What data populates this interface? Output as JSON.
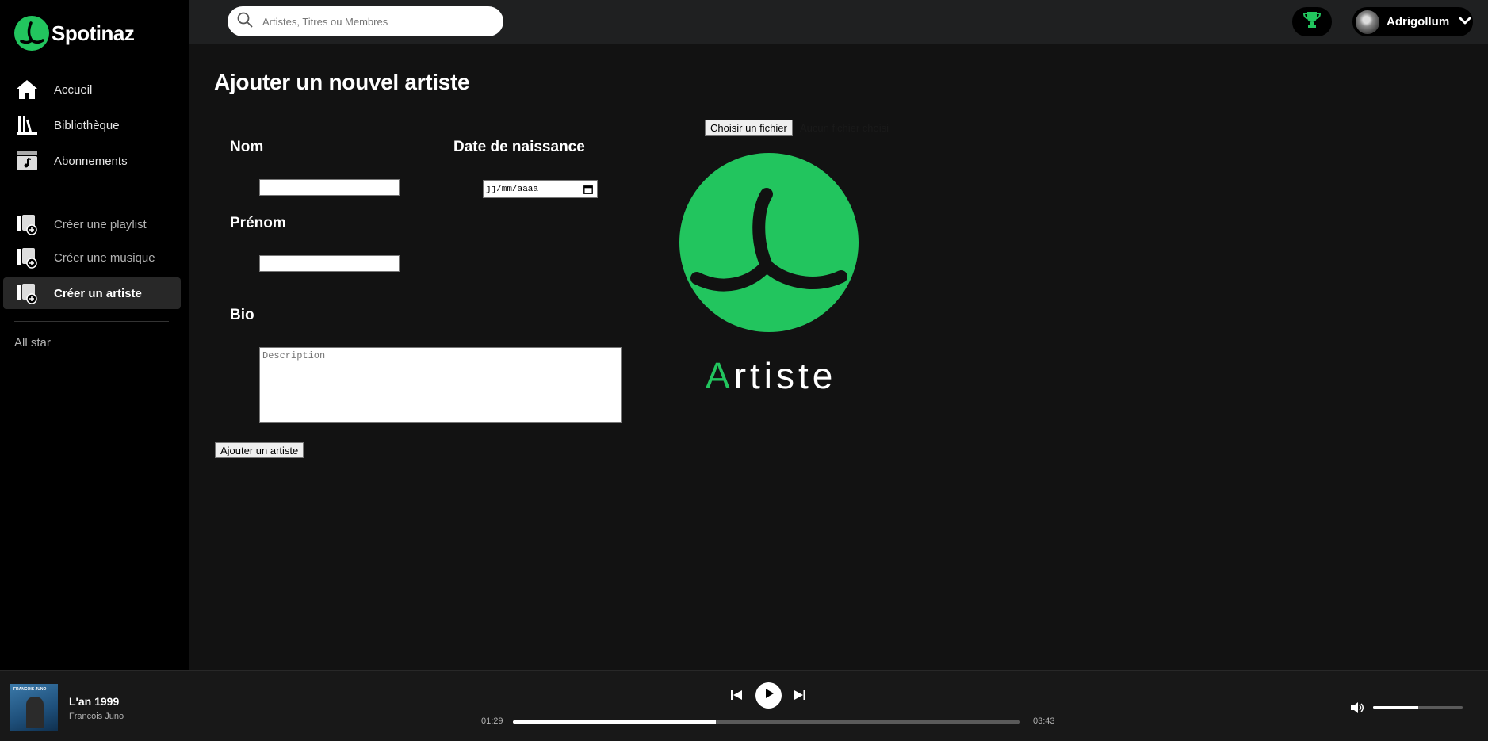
{
  "app": {
    "name": "Spotinaz",
    "accent": "#22c55e"
  },
  "sidebar": {
    "main_items": [
      {
        "label": "Accueil",
        "icon": "home-icon"
      },
      {
        "label": "Bibliothèque",
        "icon": "library-icon"
      },
      {
        "label": "Abonnements",
        "icon": "music-note-icon"
      }
    ],
    "create_items": [
      {
        "label": "Créer une playlist",
        "icon": "add-playlist-icon"
      },
      {
        "label": "Créer une musique",
        "icon": "add-music-icon"
      },
      {
        "label": "Créer un artiste",
        "icon": "add-artist-icon",
        "active": true
      }
    ],
    "playlists": [
      "All star"
    ]
  },
  "topbar": {
    "search_placeholder": "Artistes, Titres ou Membres",
    "username": "Adrigollum"
  },
  "form": {
    "title": "Ajouter un nouvel artiste",
    "nom_label": "Nom",
    "prenom_label": "Prénom",
    "date_label": "Date de naissance",
    "date_placeholder": "jj/mm/aaaa",
    "bio_label": "Bio",
    "bio_placeholder": "Description",
    "file_button": "Choisir un fichier",
    "file_status": "Aucun fichier choisi",
    "submit_label": "Ajouter un artiste",
    "preview_word_first": "A",
    "preview_word_rest": "rtiste"
  },
  "player": {
    "track_title": "L'an 1999",
    "track_artist": "Francois Juno",
    "cover_text": "FRANCOIS JUNO",
    "elapsed": "01:29",
    "duration": "03:43",
    "progress_percent": 40,
    "volume_percent": 50
  }
}
